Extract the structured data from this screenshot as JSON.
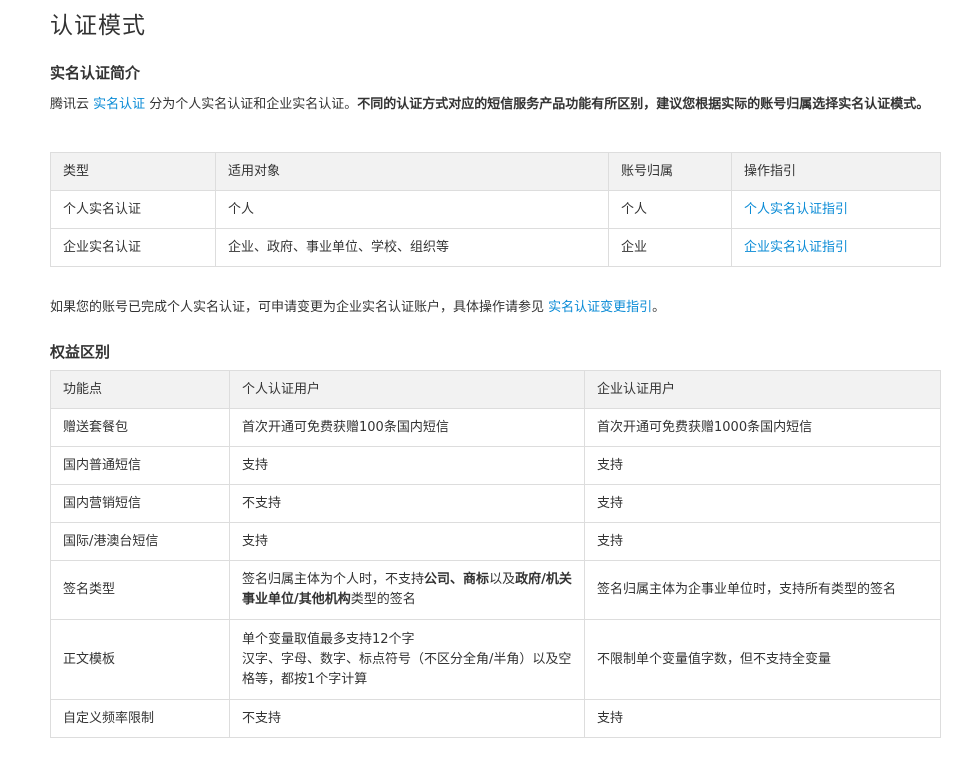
{
  "page_title": "认证模式",
  "intro": {
    "heading": "实名认证简介",
    "text_prefix": "腾讯云 ",
    "link_label": "实名认证",
    "text_middle": " 分为个人实名认证和企业实名认证。",
    "text_bold": "不同的认证方式对应的短信服务产品功能有所区别，建议您根据实际的账号归属选择实名认证模式。"
  },
  "types_table": {
    "headers": [
      "类型",
      "适用对象",
      "账号归属",
      "操作指引"
    ],
    "rows": [
      {
        "type": "个人实名认证",
        "target": "个人",
        "owner": "个人",
        "guide": "个人实名认证指引"
      },
      {
        "type": "企业实名认证",
        "target": "企业、政府、事业单位、学校、组织等",
        "owner": "企业",
        "guide": "企业实名认证指引"
      }
    ]
  },
  "note": {
    "text": "如果您的账号已完成个人实名认证，可申请变更为企业实名认证账户，具体操作请参见 ",
    "link_label": "实名认证变更指引",
    "suffix": "。"
  },
  "rights": {
    "heading": "权益区别",
    "headers": [
      "功能点",
      "个人认证用户",
      "企业认证用户"
    ],
    "rows": [
      {
        "feature": "赠送套餐包",
        "personal": "首次开通可免费获赠100条国内短信",
        "enterprise": "首次开通可免费获赠1000条国内短信"
      },
      {
        "feature": "国内普通短信",
        "personal": "支持",
        "enterprise": "支持"
      },
      {
        "feature": "国内营销短信",
        "personal": "不支持",
        "enterprise": "支持"
      },
      {
        "feature": "国际/港澳台短信",
        "personal": "支持",
        "enterprise": "支持"
      },
      {
        "feature": "签名类型",
        "enterprise": "签名归属主体为企事业单位时，支持所有类型的签名"
      },
      {
        "feature": "正文模板",
        "enterprise": "不限制单个变量值字数，但不支持全变量"
      },
      {
        "feature": "自定义频率限制",
        "personal": "不支持",
        "enterprise": "支持"
      }
    ],
    "signature_personal": {
      "p1": "签名归属主体为个人时，不支持",
      "b1": "公司",
      "sep": "、",
      "b2": "商标",
      "p2": "以及",
      "b3": "政府/机关事业单位/其他机构",
      "p3": "类型的签名"
    },
    "template_personal": {
      "line1": "单个变量取值最多支持12个字",
      "line2": "汉字、字母、数字、标点符号（不区分全角/半角）以及空格等，都按1个字计算"
    }
  }
}
